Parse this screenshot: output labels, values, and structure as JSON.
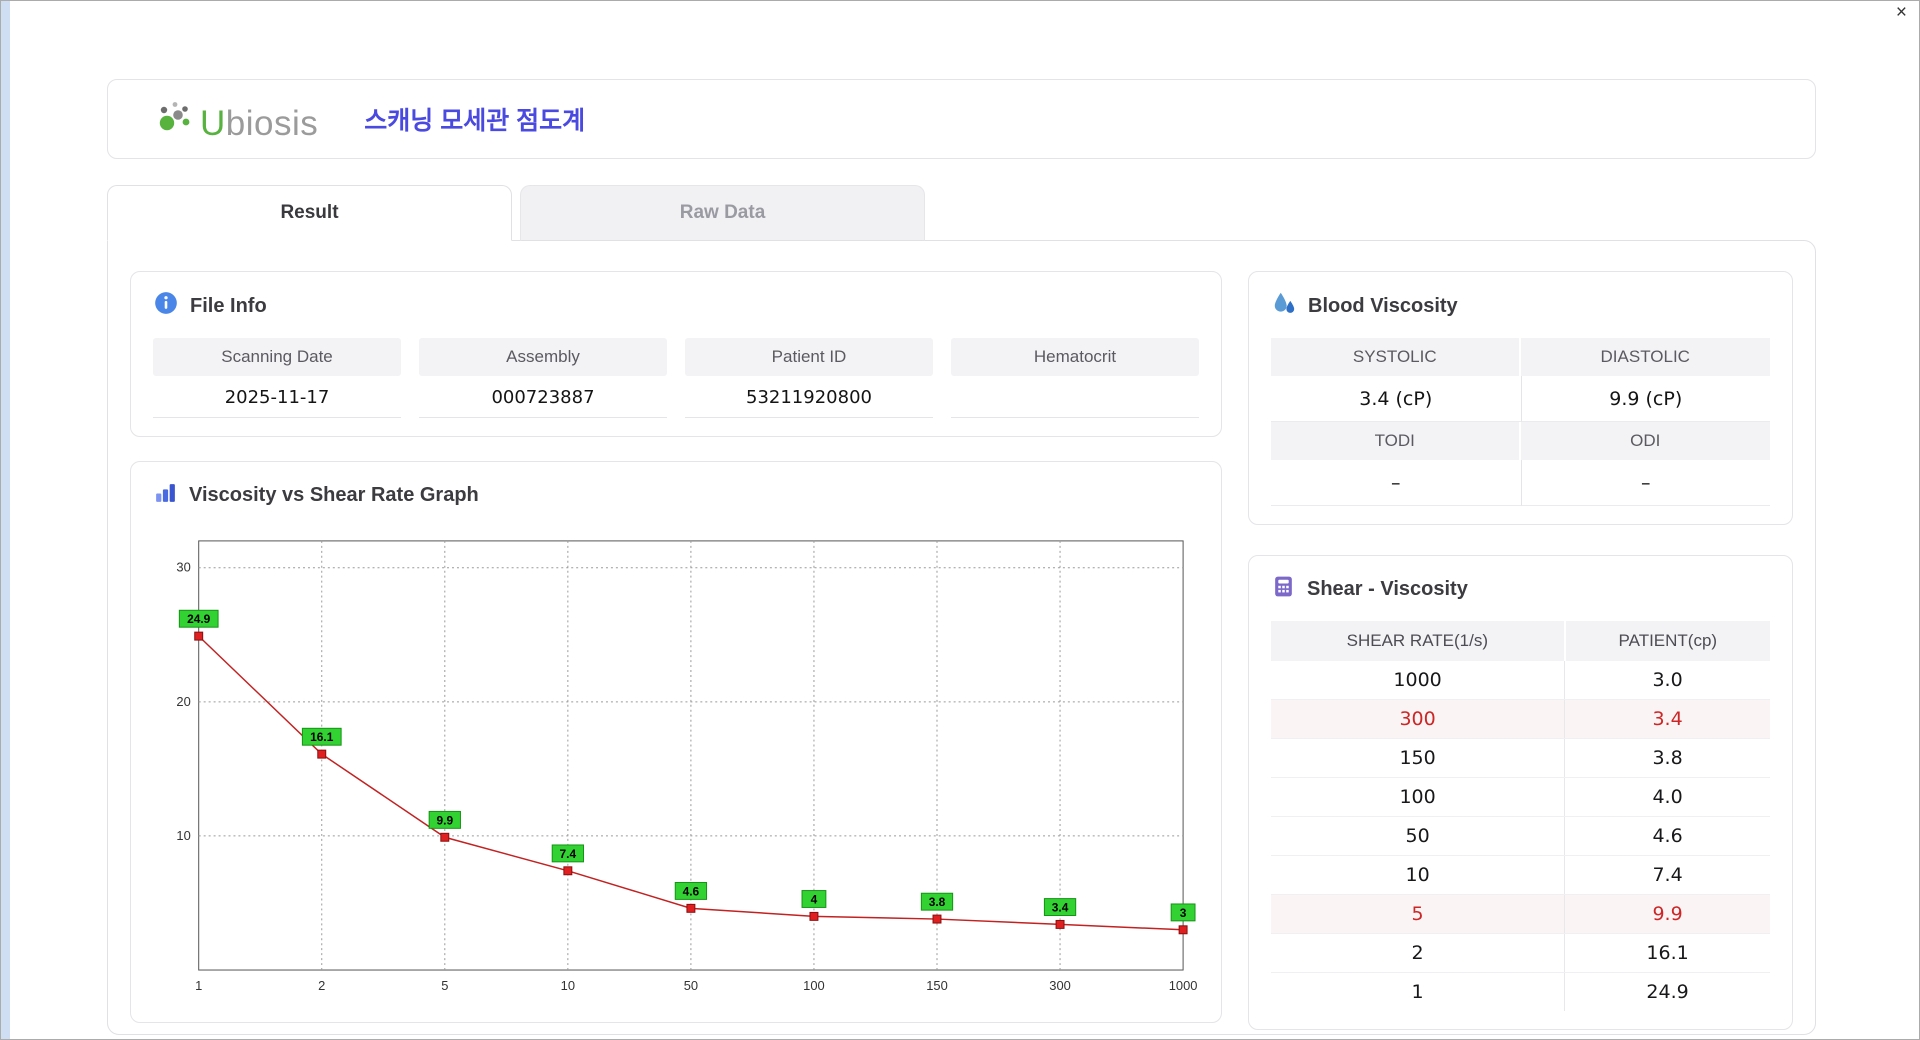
{
  "window": {
    "close_label": "×"
  },
  "header": {
    "logo_text_u": "U",
    "logo_text_rest": "biosis",
    "title": "스캐닝 모세관 점도계"
  },
  "tabs": [
    {
      "label": "Result",
      "active": true
    },
    {
      "label": "Raw Data",
      "active": false
    }
  ],
  "file_info": {
    "title": "File Info",
    "fields": [
      {
        "label": "Scanning Date",
        "value": "2025-11-17"
      },
      {
        "label": "Assembly",
        "value": "000723887"
      },
      {
        "label": "Patient ID",
        "value": "53211920800"
      },
      {
        "label": "Hematocrit",
        "value": ""
      }
    ]
  },
  "blood_viscosity": {
    "title": "Blood Viscosity",
    "top": {
      "col1_label": "SYSTOLIC",
      "col2_label": "DIASTOLIC",
      "col1_value": "3.4 (cP)",
      "col2_value": "9.9 (cP)"
    },
    "bottom": {
      "col1_label": "TODI",
      "col2_label": "ODI",
      "col1_value": "–",
      "col2_value": "–"
    }
  },
  "chart_data": {
    "type": "line",
    "title": "Viscosity vs Shear Rate Graph",
    "x": [
      1,
      2,
      5,
      10,
      50,
      100,
      150,
      300,
      1000
    ],
    "values": [
      24.9,
      16.1,
      9.9,
      7.4,
      4.6,
      4,
      3.8,
      3.4,
      3
    ],
    "point_labels": [
      "24.9",
      "16.1",
      "9.9",
      "7.4",
      "4.6",
      "4",
      "3.8",
      "3.4",
      "3"
    ],
    "x_ticks": [
      "1",
      "2",
      "5",
      "10",
      "50",
      "100",
      "150",
      "300",
      "1000"
    ],
    "y_ticks": [
      10,
      20,
      30
    ],
    "ylim": [
      0,
      32
    ],
    "x_axis_spacing": "even",
    "grid": true,
    "xlabel": "",
    "ylabel": "",
    "line_color": "#c22222",
    "marker_color": "#e02020",
    "marker_border": "#8a0d0d",
    "label_bg": "#32d232",
    "label_border": "#149314"
  },
  "shear_table": {
    "title": "Shear - Viscosity",
    "columns": [
      "SHEAR RATE(1/s)",
      "PATIENT(cp)"
    ],
    "rows": [
      {
        "shear": "1000",
        "patient": "3.0",
        "highlight": false
      },
      {
        "shear": "300",
        "patient": "3.4",
        "highlight": true
      },
      {
        "shear": "150",
        "patient": "3.8",
        "highlight": false
      },
      {
        "shear": "100",
        "patient": "4.0",
        "highlight": false
      },
      {
        "shear": "50",
        "patient": "4.6",
        "highlight": false
      },
      {
        "shear": "10",
        "patient": "7.4",
        "highlight": false
      },
      {
        "shear": "5",
        "patient": "9.9",
        "highlight": true
      },
      {
        "shear": "2",
        "patient": "16.1",
        "highlight": false
      },
      {
        "shear": "1",
        "patient": "24.9",
        "highlight": false
      }
    ]
  }
}
